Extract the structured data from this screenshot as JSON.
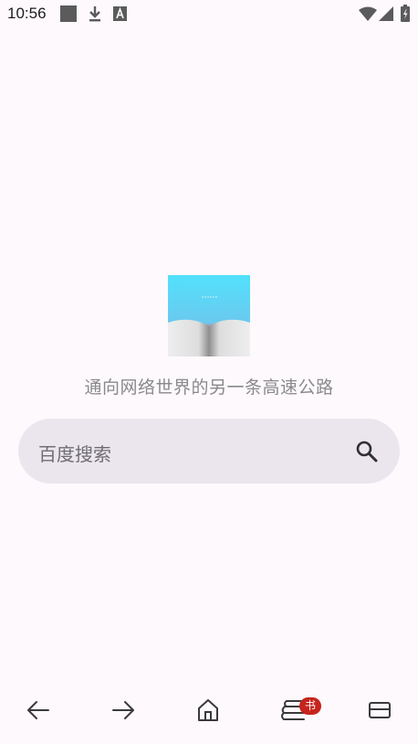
{
  "status_bar": {
    "time": "10:56",
    "left_icons": [
      "square-notification-icon",
      "download-icon",
      "text-a-icon"
    ],
    "right_icons": [
      "wifi-icon",
      "signal-icon",
      "battery-icon"
    ]
  },
  "home": {
    "slogan": "通向网络世界的另一条高速公路",
    "search": {
      "placeholder": "百度搜索"
    }
  },
  "bottom_nav": {
    "items": [
      {
        "name": "back",
        "icon": "arrow-left-icon"
      },
      {
        "name": "forward",
        "icon": "arrow-right-icon"
      },
      {
        "name": "home",
        "icon": "home-icon"
      },
      {
        "name": "bookmarks",
        "icon": "books-icon",
        "badge": "书"
      },
      {
        "name": "tabs",
        "icon": "tabs-icon"
      }
    ]
  },
  "colors": {
    "background": "#fdf9fd",
    "search_box": "#ebe6ee",
    "badge": "#c6241c",
    "slogan_text": "#8a8a8a"
  }
}
